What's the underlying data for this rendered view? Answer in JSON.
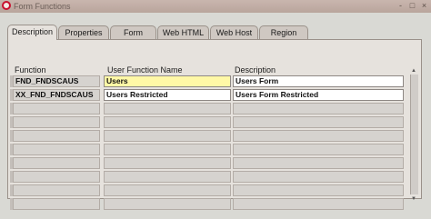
{
  "window": {
    "title": "Form Functions",
    "controls": {
      "minimize": "-",
      "maximize": "□",
      "close": "×"
    }
  },
  "tabs": [
    {
      "label": "Description",
      "active": true
    },
    {
      "label": "Properties"
    },
    {
      "label": "Form"
    },
    {
      "label": "Web HTML"
    },
    {
      "label": "Web Host"
    },
    {
      "label": "Region"
    }
  ],
  "table": {
    "headers": {
      "function": "Function",
      "user_function_name": "User Function Name",
      "description": "Description"
    },
    "rows": [
      {
        "function": "FND_FNDSCAUS",
        "user_function_name": "Users",
        "description": "Users Form"
      },
      {
        "function": "XX_FND_FNDSCAUS",
        "user_function_name": "Users Restricted",
        "description": "Users Form Restricted"
      },
      {
        "function": "",
        "user_function_name": "",
        "description": ""
      },
      {
        "function": "",
        "user_function_name": "",
        "description": ""
      },
      {
        "function": "",
        "user_function_name": "",
        "description": ""
      },
      {
        "function": "",
        "user_function_name": "",
        "description": ""
      },
      {
        "function": "",
        "user_function_name": "",
        "description": ""
      },
      {
        "function": "",
        "user_function_name": "",
        "description": ""
      },
      {
        "function": "",
        "user_function_name": "",
        "description": ""
      },
      {
        "function": "",
        "user_function_name": "",
        "description": ""
      }
    ]
  },
  "colors": {
    "current_field": "#fff8a6",
    "window_bg": "#d9d9d4",
    "titlebar": "#c3b0a7"
  }
}
